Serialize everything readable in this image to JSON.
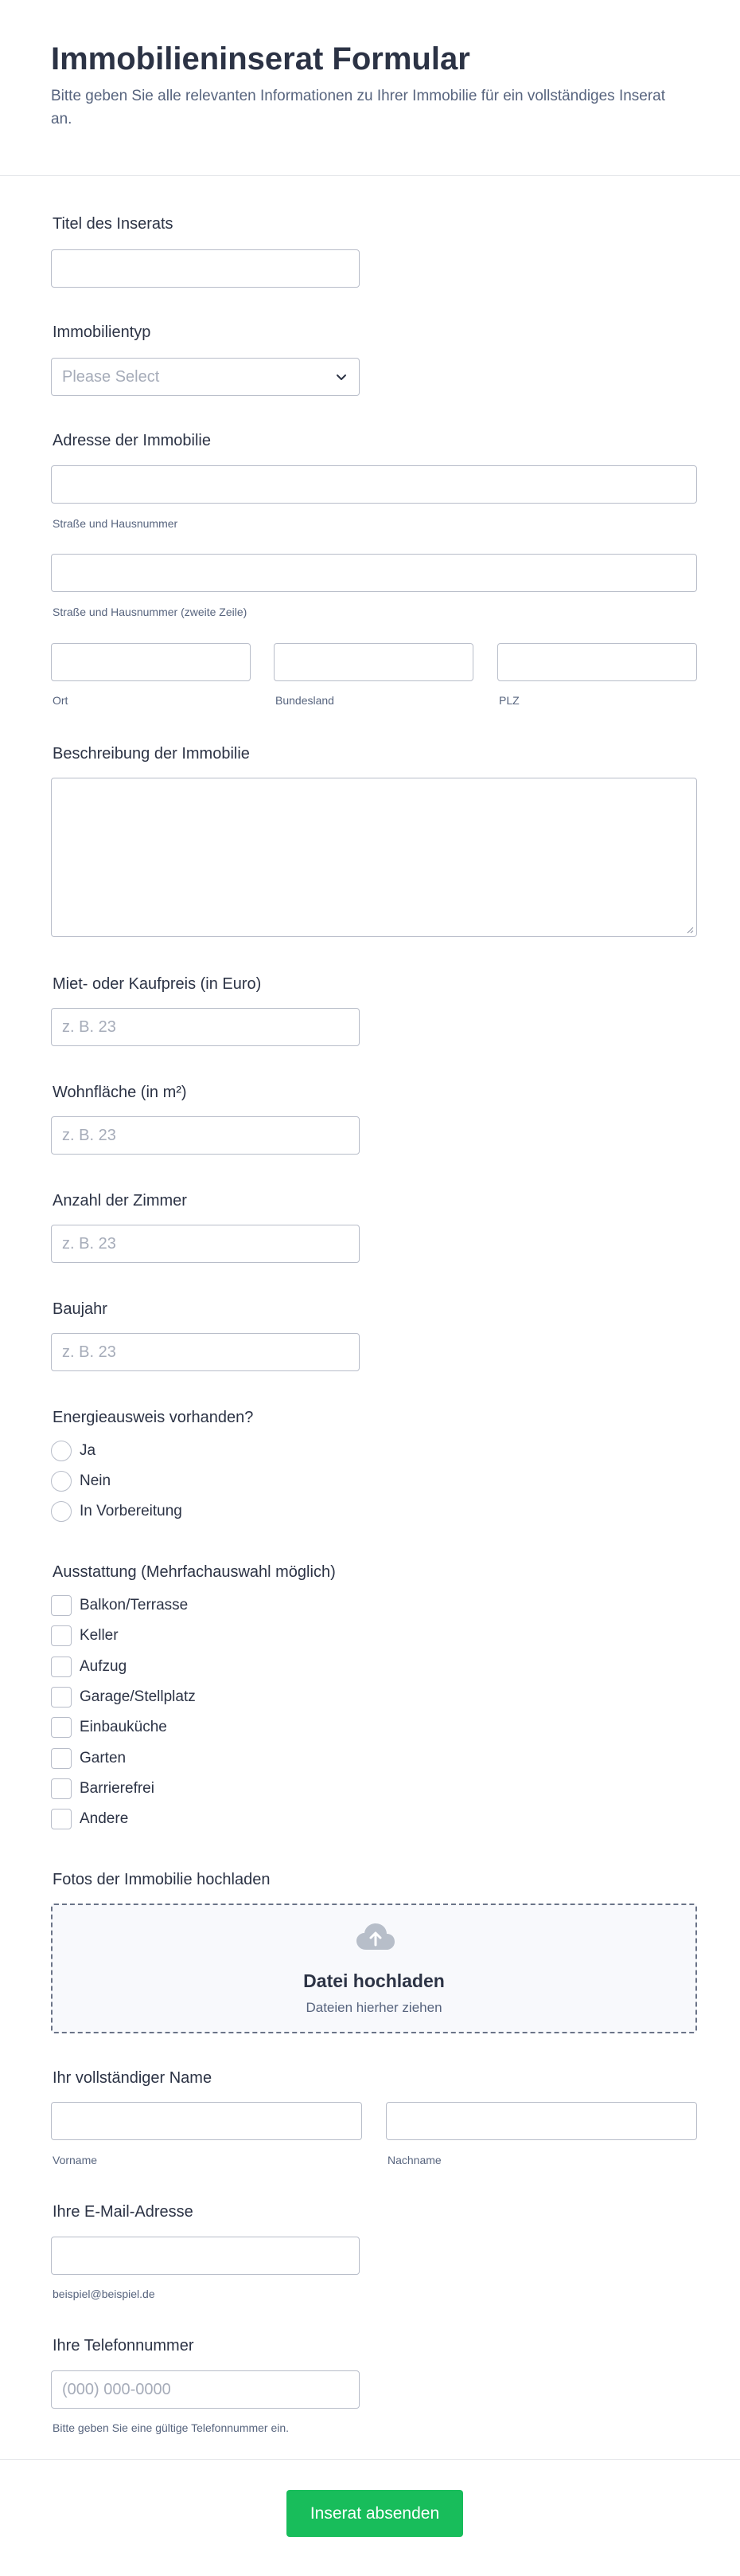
{
  "header": {
    "title": "Immobilieninserat Formular",
    "subtitle": "Bitte geben Sie alle relevanten Informationen zu Ihrer Immobilie für ein vollständiges Inserat an."
  },
  "fields": {
    "title": {
      "label": "Titel des Inserats",
      "value": ""
    },
    "property_type": {
      "label": "Immobilientyp",
      "selected": "Please Select"
    },
    "address": {
      "label": "Adresse der Immobilie",
      "street_sublabel": "Straße und Hausnummer",
      "street2_sublabel": "Straße und Hausnummer (zweite Zeile)",
      "city_sublabel": "Ort",
      "state_sublabel": "Bundesland",
      "zip_sublabel": "PLZ"
    },
    "description": {
      "label": "Beschreibung der Immobilie"
    },
    "price": {
      "label": "Miet- oder Kaufpreis (in Euro)",
      "placeholder": "z. B. 23"
    },
    "area": {
      "label": "Wohnfläche (in m²)",
      "placeholder": "z. B. 23"
    },
    "rooms": {
      "label": "Anzahl der Zimmer",
      "placeholder": "z. B. 23"
    },
    "year": {
      "label": "Baujahr",
      "placeholder": "z. B. 23"
    },
    "energy": {
      "label": "Energieausweis vorhanden?",
      "options": [
        "Ja",
        "Nein",
        "In Vorbereitung"
      ]
    },
    "features": {
      "label": "Ausstattung (Mehrfachauswahl möglich)",
      "options": [
        "Balkon/Terrasse",
        "Keller",
        "Aufzug",
        "Garage/Stellplatz",
        "Einbauküche",
        "Garten",
        "Barrierefrei",
        "Andere"
      ]
    },
    "photos": {
      "label": "Fotos der Immobilie hochladen",
      "upload_title": "Datei hochladen",
      "upload_sub": "Dateien hierher ziehen",
      "icon": "cloud-upload-icon"
    },
    "name": {
      "label": "Ihr vollständiger Name",
      "first_sublabel": "Vorname",
      "last_sublabel": "Nachname"
    },
    "email": {
      "label": "Ihre E-Mail-Adresse",
      "sublabel": "beispiel@beispiel.de"
    },
    "phone": {
      "label": "Ihre Telefonnummer",
      "placeholder": "(000) 000-0000",
      "sublabel": "Bitte geben Sie eine gültige Telefonnummer ein."
    }
  },
  "submit": {
    "label": "Inserat absenden"
  },
  "colors": {
    "accent": "#18bd5b",
    "text": "#2c3345",
    "border": "#b8bdc9",
    "upload_bg": "#f8f9fc"
  }
}
